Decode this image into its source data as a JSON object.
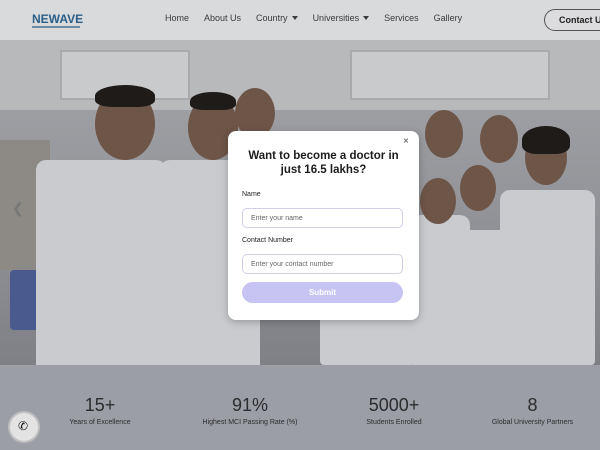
{
  "header": {
    "logo_text": "NEWAVE",
    "nav": [
      {
        "label": "Home"
      },
      {
        "label": "About Us"
      },
      {
        "label": "Country",
        "has_caret": true
      },
      {
        "label": "Universities",
        "has_caret": true
      },
      {
        "label": "Services"
      },
      {
        "label": "Gallery"
      }
    ],
    "contact_label": "Contact Us"
  },
  "modal": {
    "close_icon": "×",
    "title": "Want to become a doctor in just 16.5 lakhs?",
    "name_label": "Name",
    "name_placeholder": "Enter your name",
    "contact_label": "Contact Number",
    "contact_placeholder": "Enter your contact number",
    "submit_label": "Submit"
  },
  "stats": [
    {
      "value": "15+",
      "label": "Years of Excellence"
    },
    {
      "value": "91%",
      "label": "Highest MCI Passing Rate (%)"
    },
    {
      "value": "5000+",
      "label": "Students Enrolled"
    },
    {
      "value": "8",
      "label": "Global University Partners"
    }
  ],
  "phone_icon": "phone-icon",
  "colors": {
    "accent": "#c7c4f4",
    "overlay": "#9b9ea4"
  }
}
